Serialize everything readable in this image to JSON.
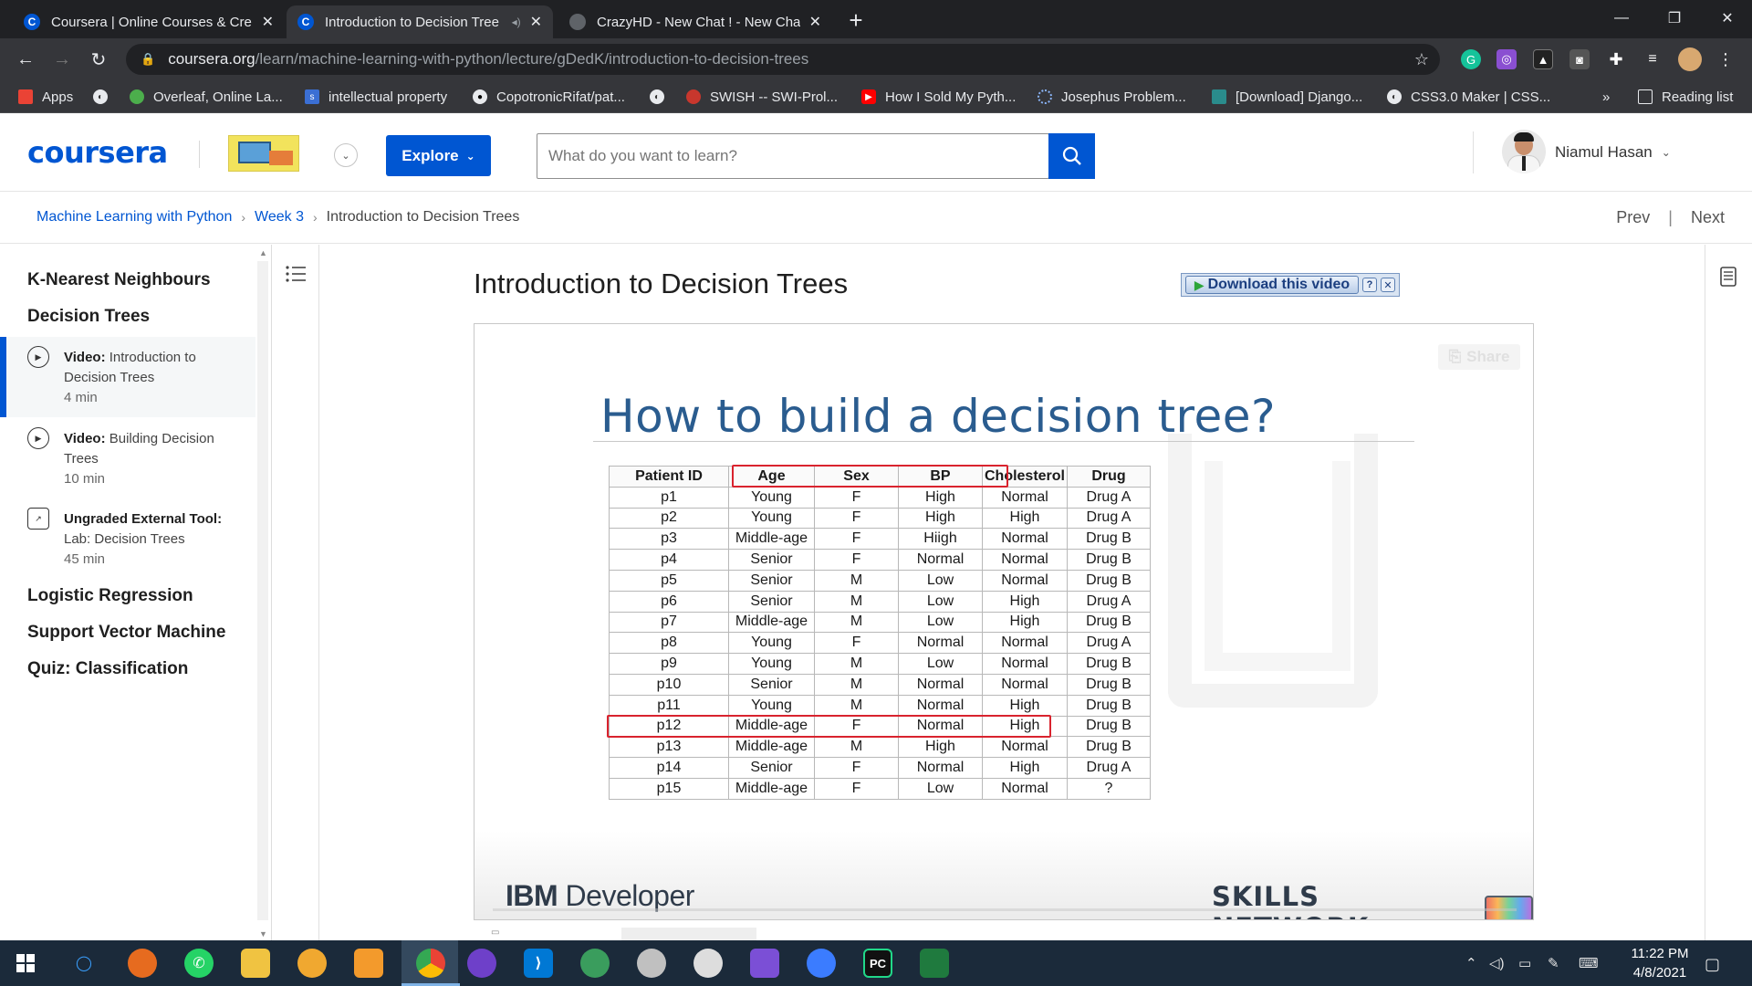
{
  "browser": {
    "tabs": [
      {
        "title": "Coursera | Online Courses & Cre",
        "favicon": "C"
      },
      {
        "title": "Introduction to Decision Tree",
        "favicon": "C"
      },
      {
        "title": "CrazyHD - New Chat ! - New Cha",
        "favicon": ""
      }
    ],
    "url_host": "coursera.org",
    "url_path": "/learn/machine-learning-with-python/lecture/gDedK/introduction-to-decision-trees",
    "bookmarks": [
      "Apps",
      "Overleaf, Online La...",
      "intellectual property",
      "CopotronicRifat/pat...",
      "SWISH -- SWI-Prol...",
      "How I Sold My Pyth...",
      "Josephus Problem...",
      "[Download] Django...",
      "CSS3.0 Maker | CSS..."
    ],
    "more": "»",
    "reading_list": "Reading list"
  },
  "header": {
    "logo": "coursera",
    "explore": "Explore",
    "search_placeholder": "What do you want to learn?",
    "user_name": "Niamul Hasan"
  },
  "breadcrumb": {
    "course": "Machine Learning with Python",
    "week": "Week 3",
    "current": "Introduction to Decision Trees",
    "prev": "Prev",
    "next": "Next"
  },
  "sidebar": {
    "sections": [
      "K-Nearest Neighbours",
      "Decision Trees"
    ],
    "items": [
      {
        "type": "Video:",
        "title": "Introduction to Decision Trees",
        "duration": "4 min"
      },
      {
        "type": "Video:",
        "title": "Building Decision Trees",
        "duration": "10 min"
      },
      {
        "type": "Ungraded External Tool:",
        "title": "Lab: Decision Trees",
        "duration": "45 min"
      }
    ],
    "more_sections": [
      "Logistic Regression",
      "Support Vector Machine",
      "Quiz: Classification"
    ]
  },
  "lecture": {
    "title": "Introduction to Decision Trees",
    "download_label": "Download this video",
    "share_label": "Share"
  },
  "slide": {
    "title": "How to build a decision tree?",
    "headers": [
      "Patient ID",
      "Age",
      "Sex",
      "BP",
      "Cholesterol",
      "Drug"
    ],
    "rows": [
      [
        "p1",
        "Young",
        "F",
        "High",
        "Normal",
        "Drug A"
      ],
      [
        "p2",
        "Young",
        "F",
        "High",
        "High",
        "Drug A"
      ],
      [
        "p3",
        "Middle-age",
        "F",
        "Hiigh",
        "Normal",
        "Drug B"
      ],
      [
        "p4",
        "Senior",
        "F",
        "Normal",
        "Normal",
        "Drug B"
      ],
      [
        "p5",
        "Senior",
        "M",
        "Low",
        "Normal",
        "Drug B"
      ],
      [
        "p6",
        "Senior",
        "M",
        "Low",
        "High",
        "Drug A"
      ],
      [
        "p7",
        "Middle-age",
        "M",
        "Low",
        "High",
        "Drug B"
      ],
      [
        "p8",
        "Young",
        "F",
        "Normal",
        "Normal",
        "Drug A"
      ],
      [
        "p9",
        "Young",
        "M",
        "Low",
        "Normal",
        "Drug B"
      ],
      [
        "p10",
        "Senior",
        "M",
        "Normal",
        "Normal",
        "Drug B"
      ],
      [
        "p11",
        "Young",
        "M",
        "Normal",
        "High",
        "Drug B"
      ],
      [
        "p12",
        "Middle-age",
        "F",
        "Normal",
        "High",
        "Drug B"
      ],
      [
        "p13",
        "Middle-age",
        "M",
        "High",
        "Normal",
        "Drug B"
      ],
      [
        "p14",
        "Senior",
        "F",
        "Normal",
        "High",
        "Drug A"
      ],
      [
        "p15",
        "Middle-age",
        "F",
        "Low",
        "Normal",
        "?"
      ]
    ],
    "footer_left_a": "IBM",
    "footer_left_b": "Developer",
    "footer_right": "SKILLS NETWORK"
  },
  "taskbar": {
    "time": "11:22 PM",
    "date": "4/8/2021"
  },
  "colors": {
    "coursera_blue": "#0056d2",
    "slide_title": "#2a5c8f",
    "highlight_red": "#d9232e"
  }
}
